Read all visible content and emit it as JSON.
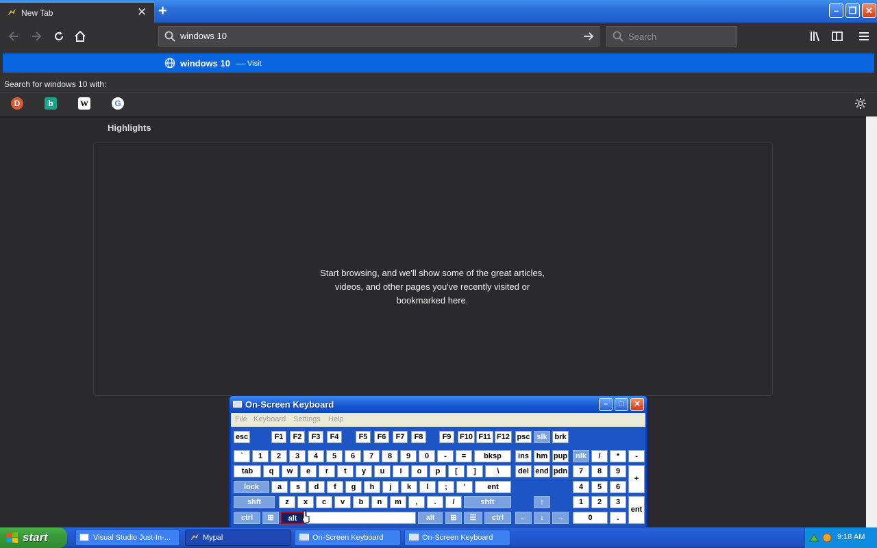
{
  "browser": {
    "tab_title": "New Tab",
    "tab_close": "✕",
    "new_tab": "+",
    "url_value": "windows 10",
    "search_placeholder": "Search",
    "window_controls": {
      "minimize": "–",
      "maximize": "❐",
      "close": "✕"
    }
  },
  "suggestion": {
    "title": "windows 10",
    "dash": "—",
    "action": "Visit"
  },
  "search_with_label": "Search for windows 10 with:",
  "engines": [
    {
      "name": "duckduckgo-icon",
      "glyph": "D",
      "color": "#de5833"
    },
    {
      "name": "bing-icon",
      "glyph": "b",
      "color": "#1aa388"
    },
    {
      "name": "wikipedia-icon",
      "glyph": "W",
      "color": "#ffffff"
    },
    {
      "name": "google-icon",
      "glyph": "G",
      "color": "#4285f4"
    }
  ],
  "content": {
    "highlights_title": "Highlights",
    "empty_message": "Start browsing, and we'll show some of the great articles, videos, and other pages you've recently visited or bookmarked here."
  },
  "osk": {
    "title": "On-Screen Keyboard",
    "menu": [
      "File",
      "Keyboard",
      "Settings",
      "Help"
    ],
    "window_controls": {
      "minimize": "–",
      "maximize": "□",
      "close": "✕"
    }
  },
  "taskbar": {
    "start_label": "start",
    "buttons": [
      "Visual Studio Just-In-...",
      "Mypal",
      "On-Screen Keyboard",
      "On-Screen Keyboard"
    ],
    "active_index": 1,
    "clock": "9:18 AM"
  }
}
